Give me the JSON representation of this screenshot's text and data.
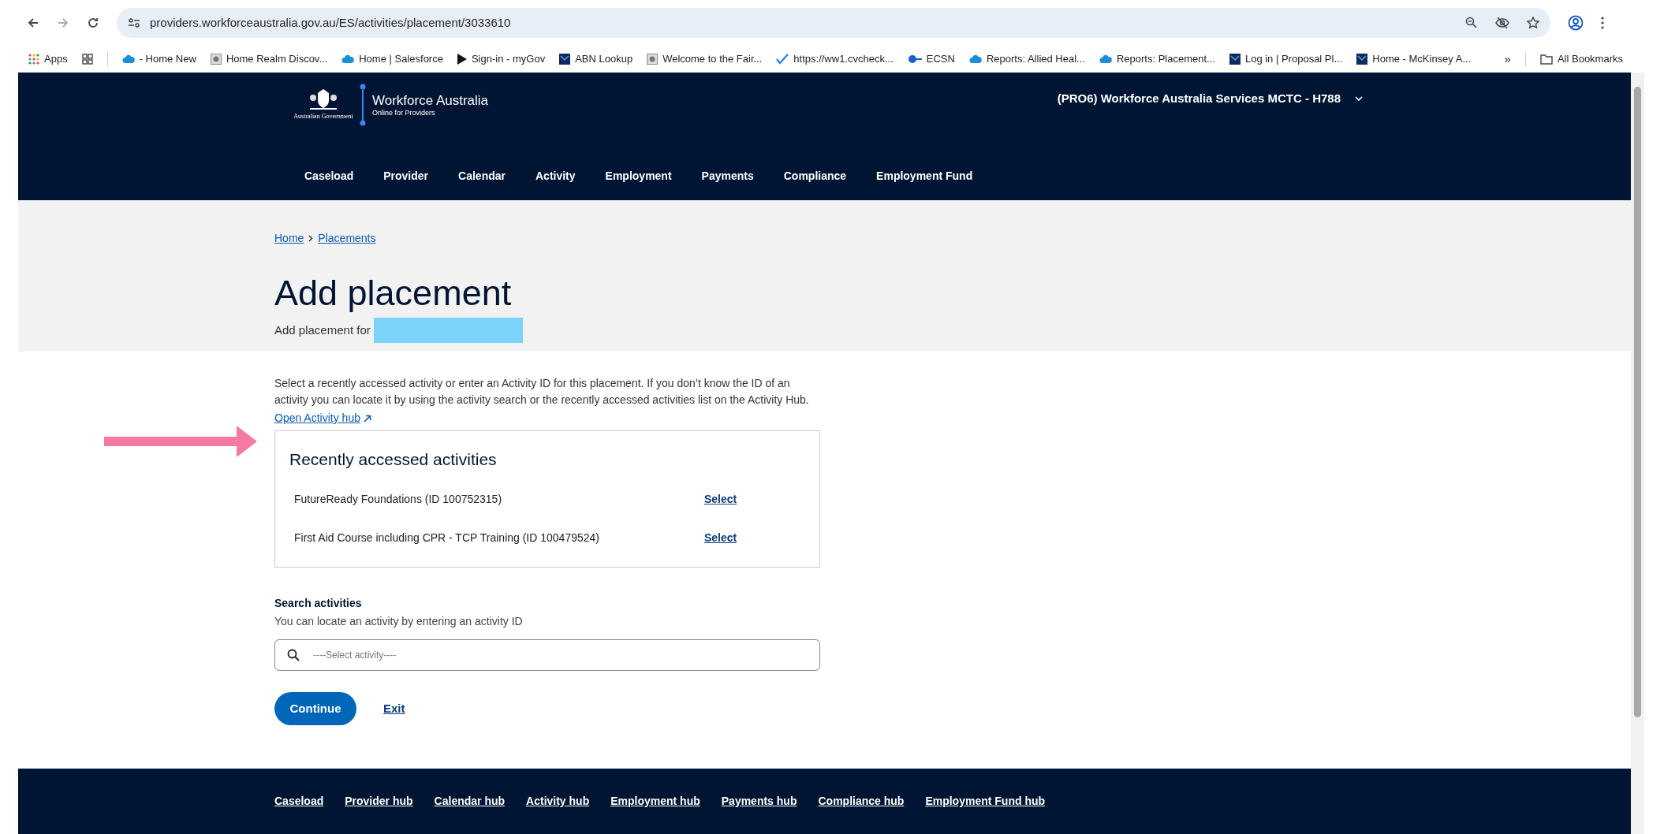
{
  "browser": {
    "address": "providers.workforceaustralia.gov.au/ES/activities/placement/3033610",
    "apps_label": "Apps",
    "bookmarks": [
      {
        "label": "- Home New",
        "kind": "cloud"
      },
      {
        "label": "Home Realm Discov...",
        "kind": "page"
      },
      {
        "label": "Home | Salesforce",
        "kind": "cloud"
      },
      {
        "label": "Sign-in - myGov",
        "kind": "play"
      },
      {
        "label": "ABN Lookup",
        "kind": "tile"
      },
      {
        "label": "Welcome to the Fair...",
        "kind": "page"
      },
      {
        "label": "https://ww1.cvcheck...",
        "kind": "check"
      },
      {
        "label": "ECSN",
        "kind": "dot"
      },
      {
        "label": "Reports: Allied Heal...",
        "kind": "cloud"
      },
      {
        "label": "Reports: Placement...",
        "kind": "cloud"
      },
      {
        "label": "Log in | Proposal Pl...",
        "kind": "tile"
      },
      {
        "label": "Home - McKinsey A...",
        "kind": "tile"
      }
    ],
    "overflow": "»",
    "all_bookmarks": "All Bookmarks"
  },
  "header": {
    "gov_label": "Australian Government",
    "brand": "Workforce Australia",
    "brand_sub": "Online for Providers",
    "organisation": "(PRO6) Workforce Australia Services MCTC - H788",
    "nav": [
      "Caseload",
      "Provider",
      "Calendar",
      "Activity",
      "Employment",
      "Payments",
      "Compliance",
      "Employment Fund"
    ]
  },
  "breadcrumbs": [
    "Home",
    "Placements"
  ],
  "title": "Add placement",
  "subtitle": "Add placement for",
  "intro": "Select a recently accessed activity or enter an Activity ID for this placement. If you don’t know the ID of an activity you can locate it by using the activity search or the recently accessed activities list on the Activity Hub.",
  "hub_link": "Open Activity hub",
  "recent": {
    "title": "Recently accessed activities",
    "items": [
      {
        "name": "FutureReady Foundations (ID 100752315)",
        "action": "Select"
      },
      {
        "name": "First Aid Course including CPR - TCP Training (ID 100479524)",
        "action": "Select"
      }
    ]
  },
  "search": {
    "label": "Search activities",
    "hint": "You can locate an activity by entering an activity ID",
    "placeholder": "----Select activity----"
  },
  "buttons": {
    "primary": "Continue",
    "secondary": "Exit"
  },
  "footer": [
    "Caseload",
    "Provider hub",
    "Calendar hub",
    "Activity hub",
    "Employment hub",
    "Payments hub",
    "Compliance hub",
    "Employment Fund hub"
  ]
}
